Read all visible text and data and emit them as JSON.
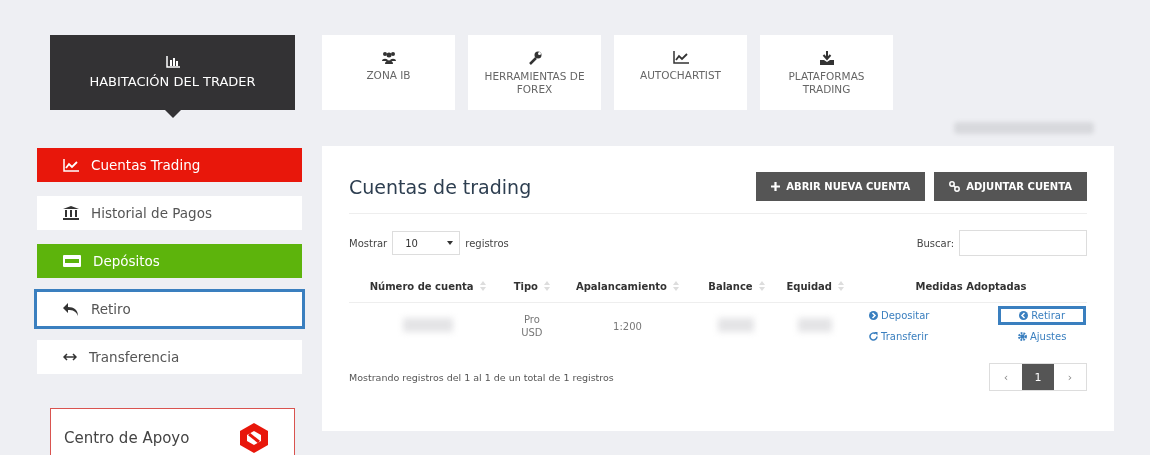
{
  "header": {
    "title": "HABITACIÓN DEL TRADER"
  },
  "top_tiles": [
    {
      "label": "ZONA IB"
    },
    {
      "label": "HERRAMIENTAS DE FOREX"
    },
    {
      "label": "AUTOCHARTIST"
    },
    {
      "label": "PLATAFORMAS TRADING"
    }
  ],
  "sidebar": {
    "items": [
      {
        "label": "Cuentas Trading",
        "color": "#e8170b",
        "highlighted": false
      },
      {
        "label": "Historial de Pagos",
        "color": "#ffffff",
        "highlighted": false
      },
      {
        "label": "Depósitos",
        "color": "#5db40c",
        "highlighted": false
      },
      {
        "label": "Retiro",
        "color": "#ffffff",
        "highlighted": true
      },
      {
        "label": "Transferencia",
        "color": "#ffffff",
        "highlighted": false
      }
    ]
  },
  "support": {
    "title": "Centro de Apoyo"
  },
  "panel": {
    "title": "Cuentas de trading",
    "buttons": [
      {
        "label": "ABRIR NUEVA CUENTA"
      },
      {
        "label": "ADJUNTAR CUENTA"
      }
    ],
    "show": {
      "before": "Mostrar",
      "value": "10",
      "after": "registros"
    },
    "search": {
      "label": "Buscar:"
    },
    "table": {
      "columns": [
        {
          "label": "Número de cuenta",
          "sortable": true
        },
        {
          "label": "Tipo",
          "sortable": true
        },
        {
          "label": "Apalancamiento",
          "sortable": true
        },
        {
          "label": "Balance",
          "sortable": true
        },
        {
          "label": "Equidad",
          "sortable": true
        },
        {
          "label": "Medidas Adoptadas",
          "sortable": false
        }
      ],
      "rows": [
        {
          "tipo": [
            "Pro",
            "USD"
          ],
          "leverage": "1:200",
          "actions_left": [
            {
              "label": "Depositar",
              "highlighted": false
            },
            {
              "label": "Transferir",
              "highlighted": false
            }
          ],
          "actions_right": [
            {
              "label": "Retirar",
              "highlighted": true
            },
            {
              "label": "Ajustes",
              "highlighted": false
            }
          ]
        }
      ]
    },
    "info": "Mostrando registros del 1 al 1 de un total de 1 registros",
    "pagination": [
      {
        "label": "‹",
        "selected": false
      },
      {
        "label": "1",
        "selected": true
      },
      {
        "label": "›",
        "selected": false
      }
    ]
  }
}
